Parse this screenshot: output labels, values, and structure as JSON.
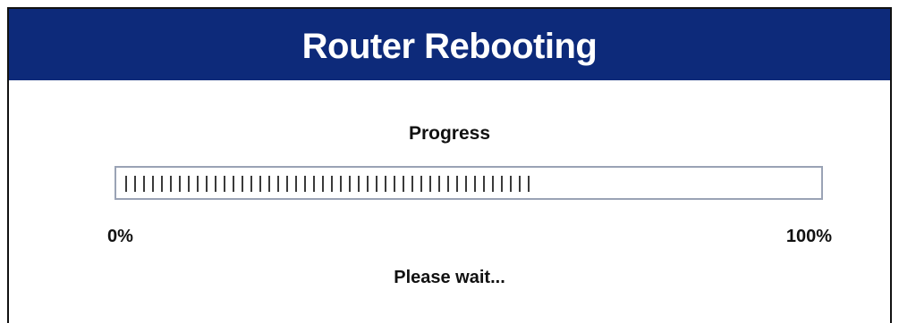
{
  "dialog": {
    "title": "Router Rebooting",
    "header_color": "#0d2a7a"
  },
  "progress": {
    "label": "Progress",
    "min_label": "0%",
    "max_label": "100%",
    "fraction": 0.59,
    "status": "Please wait..."
  }
}
